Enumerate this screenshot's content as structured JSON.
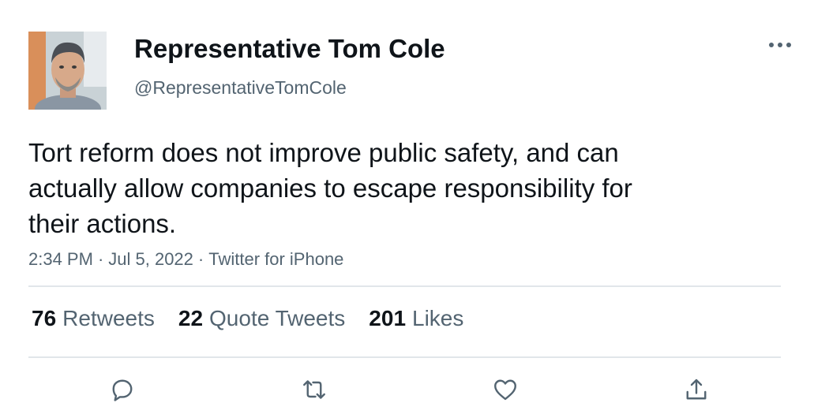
{
  "author": {
    "display_name": "Representative Tom Cole",
    "handle": "@RepresentativeTomCole",
    "avatar_icon": "profile-photo"
  },
  "tweet": {
    "text": "Tort reform does not improve public safety, and can\nactually allow companies to escape responsibility for\ntheir actions.",
    "time": "2:34 PM",
    "date": "Jul 5, 2022",
    "source": "Twitter for iPhone",
    "separator": "·"
  },
  "stats": {
    "retweets": {
      "count": "76",
      "label": "Retweets"
    },
    "quote_tweets": {
      "count": "22",
      "label": "Quote Tweets"
    },
    "likes": {
      "count": "201",
      "label": "Likes"
    }
  },
  "actions": [
    "reply-icon",
    "retweet-icon",
    "like-icon",
    "share-icon"
  ],
  "colors": {
    "text_primary": "#0f1419",
    "text_secondary": "#536471",
    "divider": "#e1e6ea"
  }
}
